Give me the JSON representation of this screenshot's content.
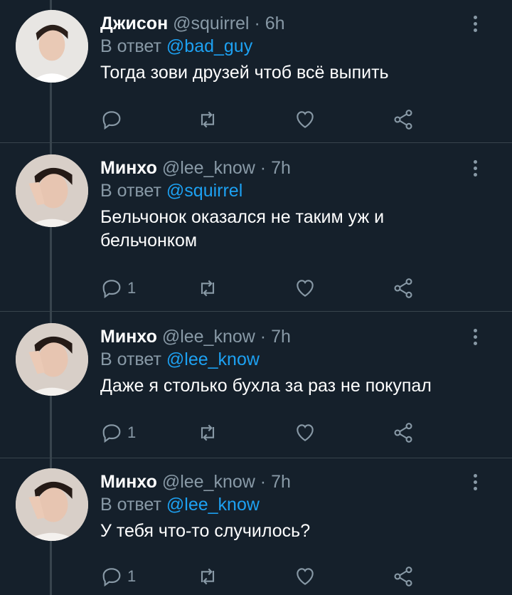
{
  "tweets": [
    {
      "name": "Джисон",
      "handle": "@squirrel",
      "time": "6h",
      "reply_prefix": "В ответ",
      "reply_to": "@bad_guy",
      "text": "Тогда зови друзей чтоб всё выпить",
      "reply_count": ""
    },
    {
      "name": "Минхо",
      "handle": "@lee_know",
      "time": "7h",
      "reply_prefix": "В ответ",
      "reply_to": "@squirrel",
      "text": "Бельчонок оказался не таким уж и бельчонком",
      "reply_count": "1"
    },
    {
      "name": "Минхо",
      "handle": "@lee_know",
      "time": "7h",
      "reply_prefix": "В ответ",
      "reply_to": "@lee_know",
      "text": "Даже я столько бухла за раз не покупал",
      "reply_count": "1"
    },
    {
      "name": "Минхо",
      "handle": "@lee_know",
      "time": "7h",
      "reply_prefix": "В ответ",
      "reply_to": "@lee_know",
      "text": "У тебя что-то случилось?",
      "reply_count": "1"
    }
  ],
  "separator": "·",
  "colors": {
    "background": "#15202b",
    "link": "#1da1f2",
    "muted": "#8899a6",
    "divider": "#38444d"
  },
  "icons": [
    "reply-icon",
    "retweet-icon",
    "like-icon",
    "share-icon",
    "more-options-icon"
  ]
}
